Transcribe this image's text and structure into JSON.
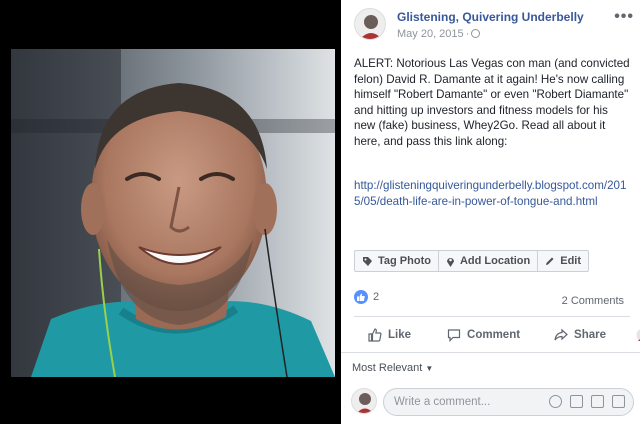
{
  "post": {
    "page_name": "Glistening, Quivering Underbelly",
    "date": "May 20, 2015",
    "separator": "·",
    "audience_icon": "globe-icon",
    "more_icon": "ellipsis-icon",
    "more_glyph": "•••",
    "text": "ALERT: Notorious Las Vegas con man (and convicted felon) David R. Damante at it again! He's now calling himself \"Robert Damante\" or even \"Robert Diamante\" and hitting up investors and fitness models for his new (fake) business, Whey2Go. Read all about it here, and pass this link along:",
    "link": "http://glisteningquiveringunderbelly.blogspot.com/2015/05/death-life-are-in-power-of-tongue-and.html"
  },
  "photo_actions": {
    "tag_label": "Tag Photo",
    "location_label": "Add Location",
    "edit_label": "Edit"
  },
  "reactions": {
    "like_count": "2",
    "comments_label": "2 Comments"
  },
  "actions": {
    "like_label": "Like",
    "comment_label": "Comment",
    "share_label": "Share"
  },
  "comments": {
    "sort_label": "Most Relevant",
    "placeholder": "Write a comment..."
  },
  "colors": {
    "link_blue": "#385898",
    "like_blue": "#5890ff",
    "text": "#1d2129",
    "muted": "#90949c"
  }
}
